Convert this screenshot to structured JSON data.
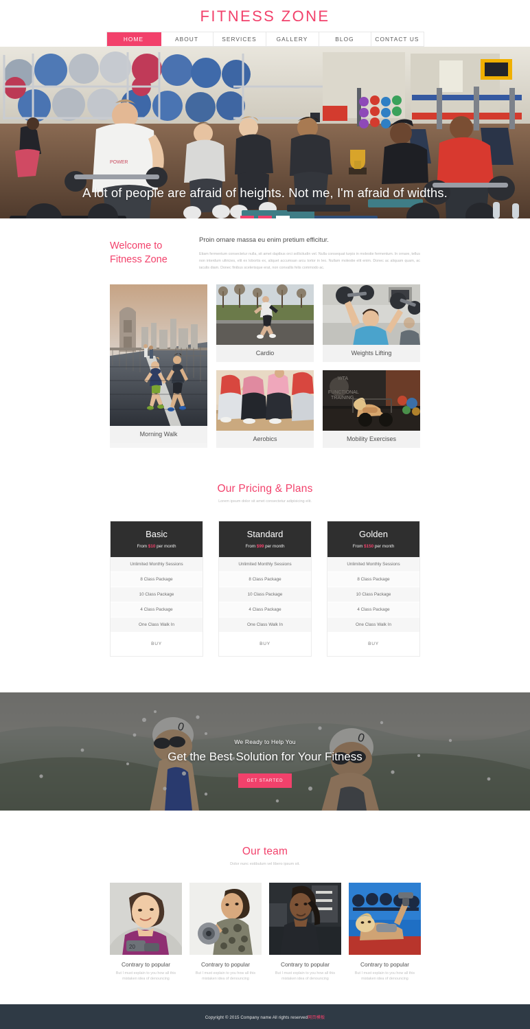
{
  "header": {
    "brand": "FITNESS ZONE",
    "nav": [
      {
        "label": "HOME",
        "active": true
      },
      {
        "label": "ABOUT",
        "active": false
      },
      {
        "label": "SERVICES",
        "active": false
      },
      {
        "label": "GALLERY",
        "active": false
      },
      {
        "label": "BLOG",
        "active": false
      },
      {
        "label": "CONTACT US",
        "active": false
      }
    ]
  },
  "hero": {
    "caption": "A lot of people are afraid of heights. Not me, I'm afraid of widths.",
    "slides": 3,
    "active_slide": 3,
    "image_alt": "gym-floor-group-workout"
  },
  "welcome": {
    "title_line1": "Welcome to",
    "title_line2": "Fitness Zone",
    "lead": "Proin ornare massa eu enim pretium efficitur.",
    "body": "Etiam fermentum consectetur nulla, sit amet dapibus orci sollicitudin vel. Nulla consequat turpis in molestie fermentum. In ornare, tellus non interdum ultricies, elit ex lobortis ex, aliquet accumsan arcu tortor in leo. Nullam molestie elit enim. Donec ac aliquam quam, ac iaculis diam. Donec finibus scelerisque erat, non convallis felis commodo ac."
  },
  "gallery": [
    {
      "label": "Cardio",
      "image_alt": "woman-running-park"
    },
    {
      "label": "Morning Walk",
      "image_alt": "runners-on-bridge-boardwalk"
    },
    {
      "label": "Weights Lifting",
      "image_alt": "woman-shoulder-press-dumbbells"
    },
    {
      "label": "Aerobics",
      "image_alt": "aerobics-step-class"
    },
    {
      "label": "Mobility Exercises",
      "image_alt": "woman-kettlebell-plank"
    }
  ],
  "pricing": {
    "title": "Our Pricing & Plans",
    "subtitle": "Lorem ipsum dolor sit amet consectetur adipisicing elit.",
    "price_prefix": "From",
    "price_suffix": "per month",
    "buy_label": "BUY",
    "plans": [
      {
        "name": "Basic",
        "price": "$10",
        "features": [
          "Unlimited Monthly Sessions",
          "8 Class Package",
          "10 Class Package",
          "4 Class Package",
          "One Class Walk In"
        ]
      },
      {
        "name": "Standard",
        "price": "$99",
        "features": [
          "Unlimited Monthly Sessions",
          "8 Class Package",
          "10 Class Package",
          "4 Class Package",
          "One Class Walk In"
        ]
      },
      {
        "name": "Golden",
        "price": "$150",
        "features": [
          "Unlimited Monthly Sessions",
          "8 Class Package",
          "10 Class Package",
          "4 Class Package",
          "One Class Walk In"
        ]
      }
    ]
  },
  "cta": {
    "kicker": "We Ready to Help You",
    "title": "Get the Best Solution for Your Fitness",
    "button": "GET STARTED",
    "image_alt": "two-open-water-swimmers"
  },
  "team": {
    "title": "Our team",
    "subtitle": "Dolor nunc estibulum vel libero ipsum sit.",
    "members": [
      {
        "name": "Contrary to popular",
        "desc": "But I must explain to you how all this mistaken idea of denouncing",
        "image_alt": "smiling-woman-with-dumbbell"
      },
      {
        "name": "Contrary to popular",
        "desc": "But I must explain to you how all this mistaken idea of denouncing",
        "image_alt": "woman-curling-dumbbell-camo-top"
      },
      {
        "name": "Contrary to popular",
        "desc": "But I must explain to you how all this mistaken idea of denouncing",
        "image_alt": "woman-braids-in-gym"
      },
      {
        "name": "Contrary to popular",
        "desc": "But I must explain to you how all this mistaken idea of denouncing",
        "image_alt": "woman-bench-press-dumbbell"
      }
    ]
  },
  "footer": {
    "copyright": "Copyright © 2015 Company name All rights reserved",
    "credit": "网页模板"
  },
  "colors": {
    "accent": "#f2416b",
    "dark_panel": "#2f2f2f",
    "footer_bg": "#2f3a45",
    "muted_text": "#b6b6b6"
  }
}
